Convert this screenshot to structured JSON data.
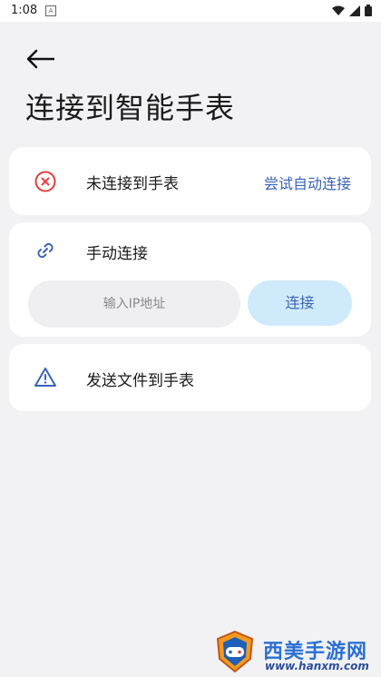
{
  "status_bar": {
    "time": "1:08",
    "notification_glyph": "A"
  },
  "header": {
    "back_icon": "arrow-left-icon",
    "title": "连接到智能手表"
  },
  "connection_status": {
    "icon": "error-circle-icon",
    "text": "未连接到手表",
    "action_label": "尝试自动连接",
    "action_color": "#3a63b8",
    "icon_color": "#e0403f"
  },
  "manual_connect": {
    "icon": "link-icon",
    "label": "手动连接",
    "input_placeholder": "输入IP地址",
    "input_value": "",
    "button_label": "连接",
    "button_bg": "#cfeafb"
  },
  "send_file": {
    "icon": "warning-triangle-icon",
    "label": "发送文件到手表"
  },
  "watermark": {
    "name": "西美手游网",
    "url": "www.hanxm.com"
  },
  "colors": {
    "background": "#f2f2f4",
    "card": "#ffffff",
    "accent": "#3a63b8"
  }
}
